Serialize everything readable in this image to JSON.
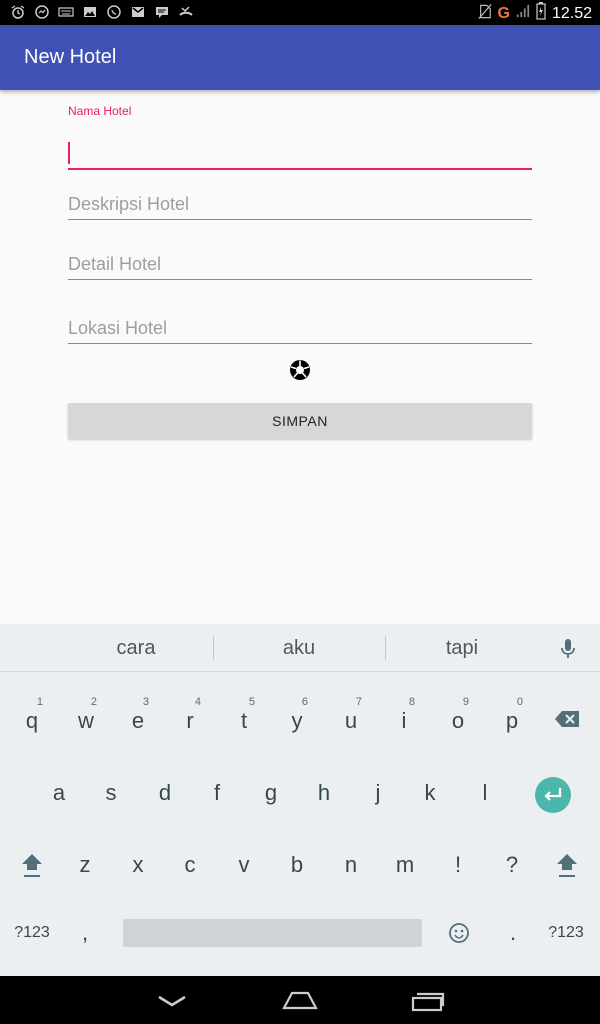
{
  "status_bar": {
    "network": "G",
    "time": "12.52"
  },
  "app_bar": {
    "title": "New Hotel"
  },
  "form": {
    "nama": {
      "label": "Nama Hotel",
      "value": ""
    },
    "deskripsi": {
      "placeholder": "Deskripsi Hotel"
    },
    "detail": {
      "placeholder": "Detail Hotel"
    },
    "lokasi": {
      "placeholder": "Lokasi Hotel"
    },
    "save_label": "SIMPAN"
  },
  "keyboard": {
    "suggestions": [
      "cara",
      "aku",
      "tapi"
    ],
    "row1": [
      "q",
      "w",
      "e",
      "r",
      "t",
      "y",
      "u",
      "i",
      "o",
      "p"
    ],
    "row1_hints": [
      "1",
      "2",
      "3",
      "4",
      "5",
      "6",
      "7",
      "8",
      "9",
      "0"
    ],
    "row2": [
      "a",
      "s",
      "d",
      "f",
      "g",
      "h",
      "j",
      "k",
      "l"
    ],
    "row3": [
      "z",
      "x",
      "c",
      "v",
      "b",
      "n",
      "m",
      "!",
      "?"
    ],
    "symbols_label": "?123",
    "comma": ",",
    "period": "."
  },
  "icons": [
    "alarm-icon",
    "messenger-icon",
    "keyboard-icon",
    "image-icon",
    "whatsapp-icon",
    "gmail-icon",
    "chat-icon",
    "missed-call-icon",
    "no-sim-icon",
    "signal-icon",
    "battery-icon",
    "camera-shutter-icon",
    "mic-icon",
    "backspace-icon",
    "enter-icon",
    "shift-icon",
    "emoji-icon",
    "back-nav-icon",
    "home-nav-icon",
    "recents-nav-icon"
  ],
  "colors": {
    "primary": "#3f51b5",
    "accent": "#e91e63",
    "enter": "#4db6ac"
  }
}
